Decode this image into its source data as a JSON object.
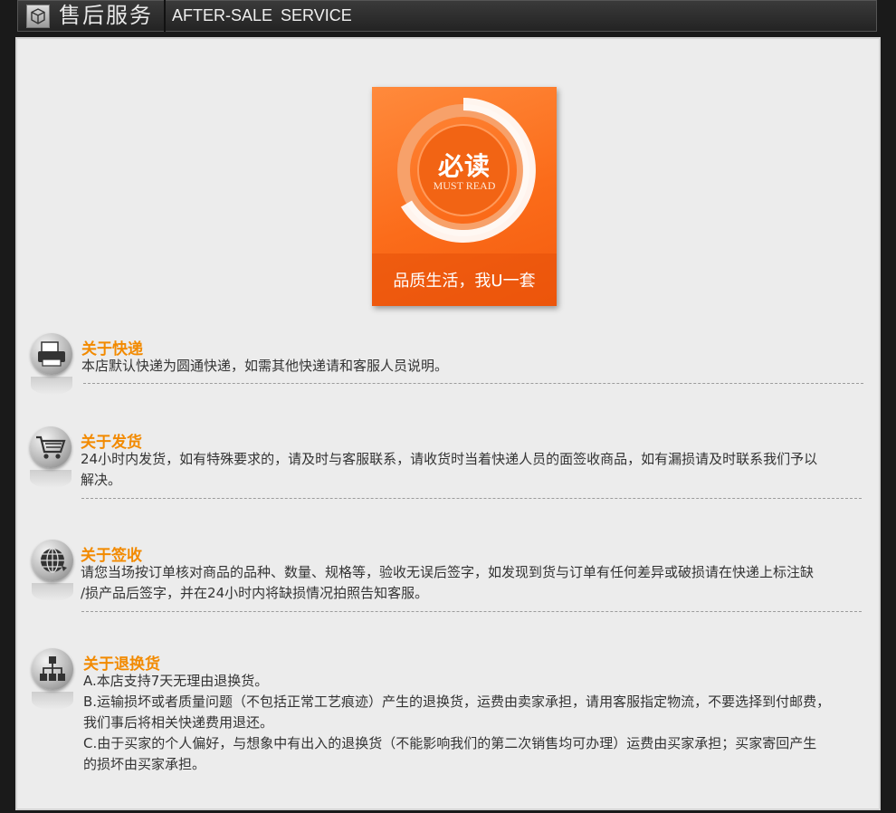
{
  "header": {
    "icon": "package-box-icon",
    "title_cn": "售后服务",
    "title_en": "AFTER-SALE  SERVICE"
  },
  "badge": {
    "title": "必读",
    "subtitle": "MUST READ",
    "slogan": "品质生活，我U一套",
    "color": "#fb6c1a"
  },
  "sections": [
    {
      "icon": "printer-icon",
      "heading": "关于快递",
      "lines": [
        "本店默认快递为圆通快递，如需其他快递请和客服人员说明。"
      ]
    },
    {
      "icon": "shopping-cart-icon",
      "heading": "关于发货",
      "lines": [
        "24小时内发货，如有特殊要求的，请及时与客服联系，请收货时当着快递人员的面签收商品，如有漏损请及时联系我们予以",
        "解决。"
      ]
    },
    {
      "icon": "globe-icon",
      "heading": "关于签收",
      "lines": [
        "请您当场按订单核对商品的品种、数量、规格等，验收无误后签字，如发现到货与订单有任何差异或破损请在快递上标注缺",
        "/损产品后签字，并在24小时内将缺损情况拍照告知客服。"
      ]
    },
    {
      "icon": "network-icon",
      "heading": "关于退换货",
      "lines": [
        "A.本店支持7天无理由退换货。",
        "B.运输损坏或者质量问题（不包括正常工艺痕迹）产生的退换货，运费由卖家承担，请用客服指定物流，不要选择到付邮费，",
        "我们事后将相关快递费用退还。",
        "C.由于买家的个人偏好，与想象中有出入的退换货（不能影响我们的第二次销售均可办理）运费由买家承担；买家寄回产生",
        "的损坏由买家承担。"
      ]
    }
  ]
}
